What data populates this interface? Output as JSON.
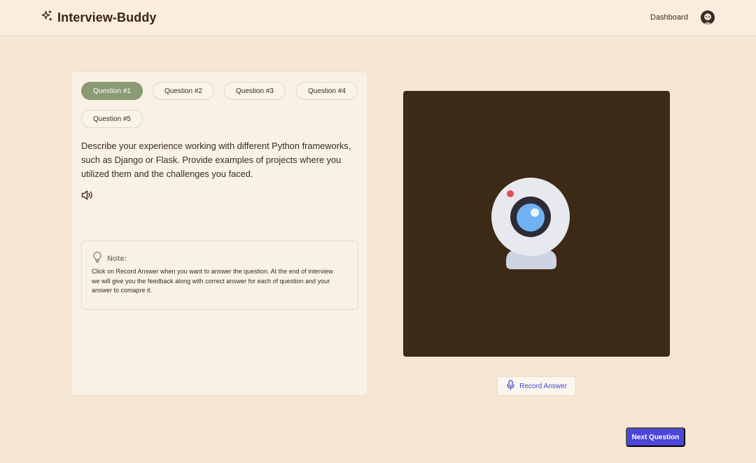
{
  "header": {
    "brand": "Interview-Buddy",
    "brand_icon": "sparkles-icon",
    "nav": {
      "dashboard": "Dashboard"
    },
    "avatar_icon": "user-avatar"
  },
  "questions": {
    "tabs": [
      {
        "label": "Question #1",
        "active": true
      },
      {
        "label": "Question #2",
        "active": false
      },
      {
        "label": "Question #3",
        "active": false
      },
      {
        "label": "Question #4",
        "active": false
      },
      {
        "label": "Question #5",
        "active": false
      }
    ],
    "current_text": "Describe your experience working with different Python frameworks, such as Django or Flask. Provide examples of projects where you utilized them and the challenges you faced.",
    "speaker_icon": "speaker-icon"
  },
  "note": {
    "icon": "lightbulb-icon",
    "title": "Note:",
    "body": "Click on Record Answer when you want to answer the question. At the end of interview we will give you the feedback along with correct answer for each of question and your answer to comapre it."
  },
  "camera": {
    "icon": "webcam-icon"
  },
  "actions": {
    "record_label": "Record Answer",
    "record_icon": "microphone-icon",
    "next_label": "Next Question"
  },
  "colors": {
    "background": "#f4e6d3",
    "active_tab": "#8a9b74",
    "camera_bg": "#3c2916",
    "accent": "#4a47d8"
  }
}
